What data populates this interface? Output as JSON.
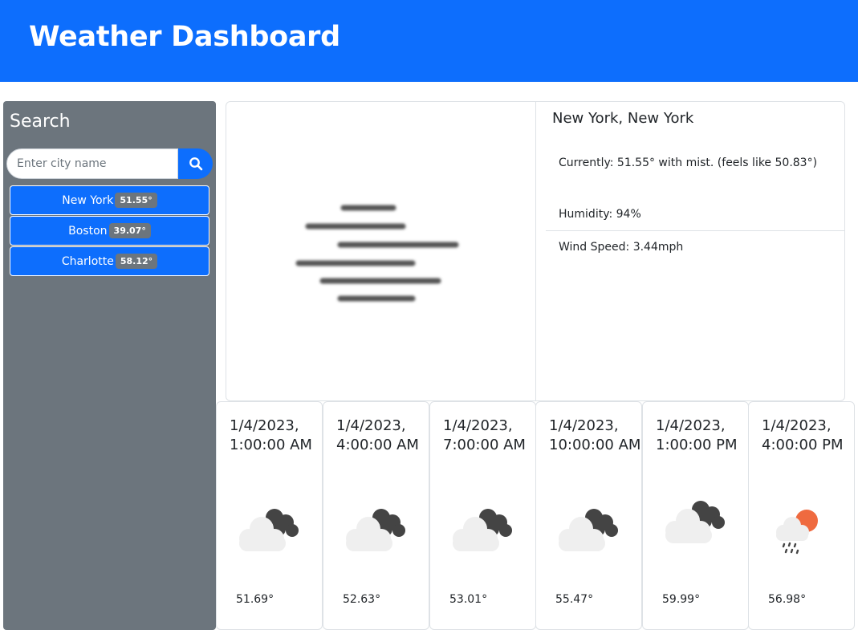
{
  "header": {
    "title": "Weather Dashboard"
  },
  "sidebar": {
    "title": "Search",
    "search": {
      "placeholder": "Enter city name",
      "value": ""
    },
    "search_icon": "search-icon",
    "cities": [
      {
        "name": "New York",
        "temp": "51.55°"
      },
      {
        "name": "Boston",
        "temp": "39.07°"
      },
      {
        "name": "Charlotte",
        "temp": "58.12°"
      }
    ]
  },
  "current": {
    "city": "New York, New York",
    "currently": "Currently: 51.55° with mist. (feels like 50.83°)",
    "humidity": "Humidity: 94%",
    "wind": "Wind Speed: 3.44mph",
    "icon": "mist-icon"
  },
  "forecast": [
    {
      "date": "1/4/2023, 1:00:00 AM",
      "temp": "51.69°",
      "icon": "broken-clouds-icon"
    },
    {
      "date": "1/4/2023, 4:00:00 AM",
      "temp": "52.63°",
      "icon": "broken-clouds-icon"
    },
    {
      "date": "1/4/2023, 7:00:00 AM",
      "temp": "53.01°",
      "icon": "broken-clouds-icon"
    },
    {
      "date": "1/4/2023, 10:00:00 AM",
      "temp": "55.47°",
      "icon": "broken-clouds-icon"
    },
    {
      "date": "1/4/2023, 1:00:00 PM",
      "temp": "59.99°",
      "icon": "broken-clouds-icon"
    },
    {
      "date": "1/4/2023, 4:00:00 PM",
      "temp": "56.98°",
      "icon": "rain-icon"
    }
  ],
  "colors": {
    "primary": "#0d6efd",
    "secondary": "#6c757d",
    "sun": "#ef6a3f"
  }
}
